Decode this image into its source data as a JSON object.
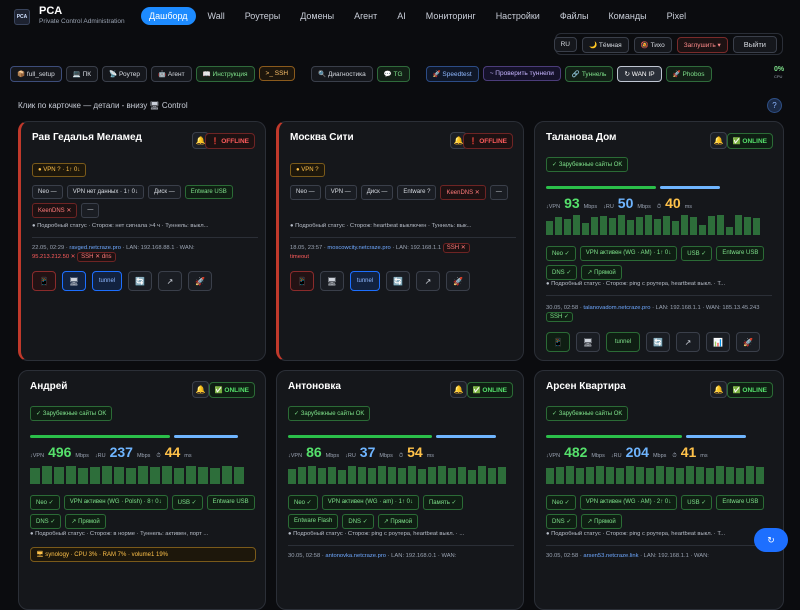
{
  "brand": {
    "logo": "PCA",
    "title": "PCA",
    "subtitle": "Private Control Administration"
  },
  "nav": [
    "Дашборд",
    "Wall",
    "Роутеры",
    "Домены",
    "Агент",
    "AI",
    "Мониторинг",
    "Настройки",
    "Файлы",
    "Команды",
    "Pixel"
  ],
  "controls": {
    "lang": "RU",
    "theme": "🌙 Тёмная",
    "quiet": "🔕 Тихо",
    "stub": "Заглушить ▾",
    "logout": "Выйти"
  },
  "toolbar": [
    "📦 full_setup",
    "💻 ПК",
    "📡 Роутер",
    "🤖 Агент",
    "📖 Инструкция",
    ">_ SSH",
    "🔍 Диагностика",
    "💬 TG",
    "🚀 Speedtest",
    "~ Проверить туннели",
    "🔗 Туннель",
    "↻ WAN IP",
    "🚀 Phobos"
  ],
  "cpu": {
    "value": "0%",
    "label": "CPU"
  },
  "hint": "Клик по карточке — детали - внизу 🖥 Control",
  "help": "?",
  "fab": "↻",
  "cards": [
    {
      "title": "Рав Гедалья Меламед",
      "status": "❗ OFFLINE",
      "vpn": "VPN ? · 1↑ 0↓",
      "chips1": [
        "Neo —",
        "VPN нет данных · 1↑ 0↓",
        "Диск —",
        "Entware USB",
        "KeenDNS ✕",
        "—"
      ],
      "detail": "● Подробный статус · Сторож: нет сигнала >4 ч · Туннель: выкл...",
      "info_time": "22.05, 02:29 ·",
      "info_link": "ravged.netcraze.pro",
      "info_rest": "· LAN: 192.168.88.1 · WAN:",
      "info_err": "95.213.212.50 ✕",
      "info_err2": "SSH ✕ dns",
      "actions": [
        "📱",
        "🖥",
        "tunnel",
        "🔄",
        "↗",
        "🚀"
      ]
    },
    {
      "title": "Москва Сити",
      "status": "❗ OFFLINE",
      "vpn": "VPN ?",
      "chips1": [
        "Neo —",
        "VPN —",
        "Диск —",
        "Entware ?",
        "KeenDNS ✕",
        "—"
      ],
      "detail": "● Подробный статус · Сторож: heartbeat выключен · Туннель: вык...",
      "info_time": "18.05, 23:57 ·",
      "info_link": "moscowcity.netcraze.pro",
      "info_rest": "· LAN: 192.168.1.1",
      "info_err": "SSH ✕",
      "info_err2": "timeout",
      "actions": [
        "📱",
        "🖥",
        "tunnel",
        "🔄",
        "↗",
        "🚀"
      ]
    },
    {
      "title": "Таланова Дом",
      "status": "✅ ONLINE",
      "ok": "✓ Зарубежные сайты OK",
      "vpn_speed": "93",
      "ru_speed": "50",
      "ping": "40",
      "vpn_frac": 0.55,
      "ru_frac": 0.3,
      "chips1": [
        "Neo ✓",
        "VPN активен (WG · AM) · 1↑ 0↓",
        "USB ✓",
        "Entware USB",
        "DNS ✓",
        "↗ Прямой"
      ],
      "detail": "● Подробный статус · Сторож: ping с роутера, heartbeat выкл. · Т...",
      "info_time": "30.05, 02:58 ·",
      "info_link": "talanovadom.netcraze.pro",
      "info_rest": "· LAN: 192.168.1.1 · WAN: 185.13.45.243",
      "info_ssh": "SSH ✓",
      "actions": [
        "📱",
        "🖥",
        "tunnel",
        "🔄",
        "↗",
        "📊",
        "🚀"
      ]
    },
    {
      "title": "Андрей",
      "status": "✅ ONLINE",
      "ok": "✓ Зарубежные сайты OK",
      "vpn_speed": "496",
      "ru_speed": "237",
      "ping": "44",
      "vpn_frac": 0.7,
      "ru_frac": 0.32,
      "chips1": [
        "Neo ✓",
        "VPN активен (WG · Polsh) · 8↑ 0↓",
        "USB ✓",
        "Entware USB",
        "DNS ✓",
        "↗ Прямой"
      ],
      "detail": "● Подробный статус · Сторож: в норме · Туннель: активен, порт ...",
      "syn": "🖥 synology · CPU 3% · RAM 7% · volume1 19%"
    },
    {
      "title": "Антоновка",
      "status": "✅ ONLINE",
      "ok": "✓ Зарубежные сайты OK",
      "vpn_speed": "86",
      "ru_speed": "37",
      "ping": "54",
      "vpn_frac": 0.72,
      "ru_frac": 0.3,
      "chips1": [
        "Neo ✓",
        "VPN активен (WG · am) · 1↑ 0↓",
        "Память ✓",
        "Entware Flash",
        "DNS ✓",
        "↗ Прямой"
      ],
      "detail": "● Подробный статус · Сторож: ping с роутера, heartbeat выкл. · ...",
      "info_time": "30.05, 02:58 ·",
      "info_link": "antonovka.netcraze.pro",
      "info_rest": "· LAN: 192.168.0.1 · WAN:"
    },
    {
      "title": "Арсен Квартира",
      "status": "✅ ONLINE",
      "ok": "✓ Зарубежные сайты OK",
      "vpn_speed": "482",
      "ru_speed": "204",
      "ping": "41",
      "vpn_frac": 0.68,
      "ru_frac": 0.3,
      "chips1": [
        "Neo ✓",
        "VPN активен (WG · AM) · 2↑ 0↓",
        "USB ✓",
        "Entware USB",
        "DNS ✓",
        "↗ Прямой"
      ],
      "detail": "● Подробный статус · Сторож: ping с роутера, heartbeat выкл. · Т...",
      "info_time": "30.05, 02:58 ·",
      "info_link": "arsen53.netcraze.link",
      "info_rest": "· LAN: 192.168.1.1 · WAN:"
    }
  ],
  "labels": {
    "vpn": "↓VPN",
    "ru": "↓RU",
    "mbps": "Mbps",
    "ping": "⏱",
    "ms": "ms"
  },
  "colors": {
    "accent": "#1d8bff",
    "online": "#55e06b",
    "offline": "#ff5c5c",
    "ping": "#ffc24a"
  }
}
